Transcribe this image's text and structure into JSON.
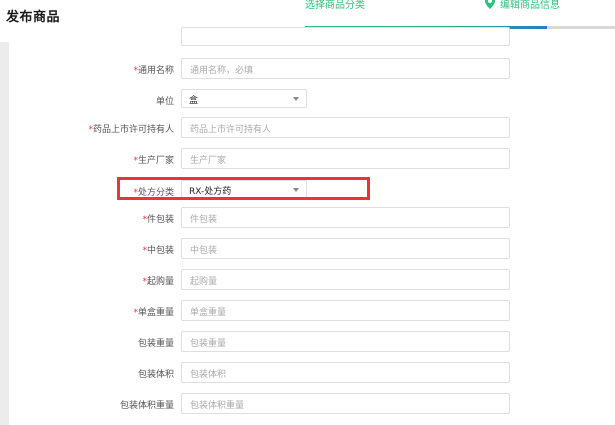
{
  "header": {
    "page_title": "发布商品",
    "steps": [
      {
        "label": "选择商品分类"
      },
      {
        "label": "编辑商品信息"
      }
    ],
    "progress": 0.78
  },
  "form": {
    "fields": [
      {
        "label": "",
        "required": false,
        "type": "input",
        "placeholder": ""
      },
      {
        "label": "通用名称",
        "required": true,
        "type": "input",
        "placeholder": "通用名称，必填"
      },
      {
        "label": "单位",
        "required": false,
        "type": "select",
        "value": "盒"
      },
      {
        "label": "药品上市许可持有人",
        "required": true,
        "type": "input",
        "placeholder": "药品上市许可持有人"
      },
      {
        "label": "生产厂家",
        "required": true,
        "type": "input",
        "placeholder": "生产厂家"
      },
      {
        "label": "处方分类",
        "required": true,
        "type": "select",
        "value": "RX-处方药"
      },
      {
        "label": "件包装",
        "required": true,
        "type": "input",
        "placeholder": "件包装"
      },
      {
        "label": "中包装",
        "required": true,
        "type": "input",
        "placeholder": "中包装"
      },
      {
        "label": "起购量",
        "required": true,
        "type": "input",
        "placeholder": "起购量"
      },
      {
        "label": "单盒重量",
        "required": true,
        "type": "input",
        "placeholder": "单盒重量"
      },
      {
        "label": "包装重量",
        "required": false,
        "type": "input",
        "placeholder": "包装重量"
      },
      {
        "label": "包装体积",
        "required": false,
        "type": "input",
        "placeholder": "包装体积"
      },
      {
        "label": "包装体积重量",
        "required": false,
        "type": "input",
        "placeholder": "包装体积重量"
      }
    ]
  },
  "colors": {
    "accent_green": "#2ec27e",
    "progress_blue": "#1f7fd1",
    "required_red": "#e4393c",
    "highlight_red": "#e8343a"
  }
}
